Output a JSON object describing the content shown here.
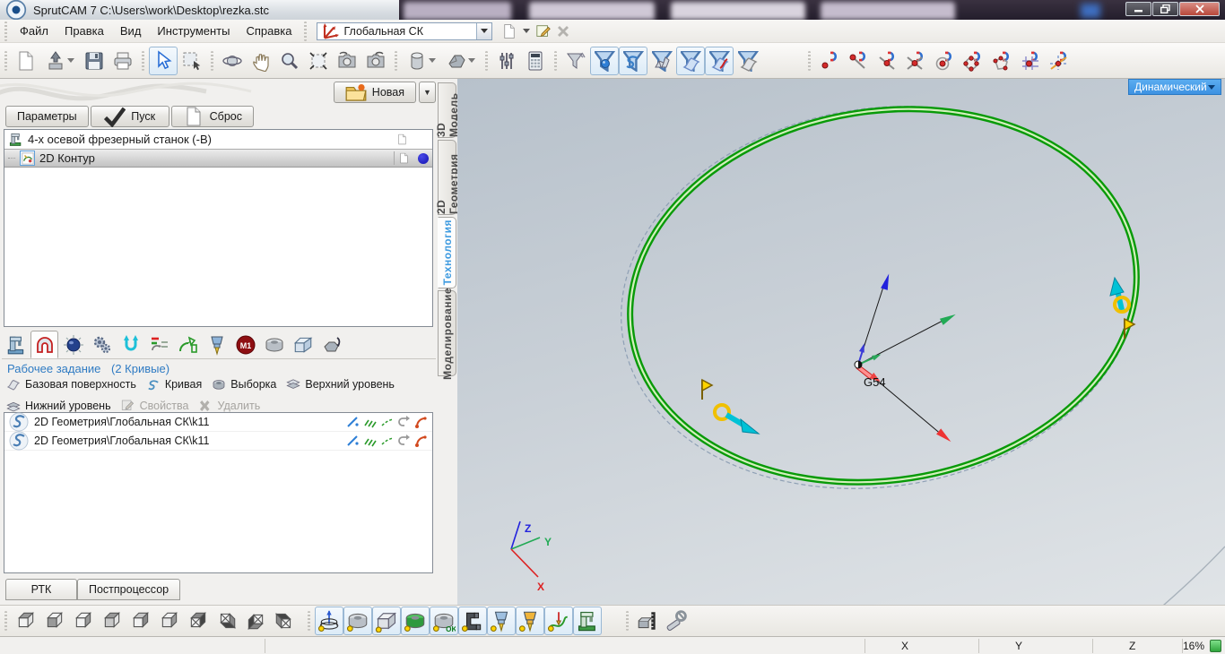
{
  "window": {
    "title": "SprutCAM 7   C:\\Users\\work\\Desktop\\rezka.stc"
  },
  "menu": [
    "Файл",
    "Правка",
    "Вид",
    "Инструменты",
    "Справка"
  ],
  "cs_combo": {
    "value": "Глобальная СК"
  },
  "toolbar_main": [
    "new-document",
    "open-import",
    "save",
    "print",
    "select",
    "rect-select",
    "rotate-view",
    "pan-view",
    "zoom-view",
    "fit-view",
    "snapshot",
    "snapshot-rotate",
    "workpiece-cylinder",
    "solid-model",
    "parameters-sliders",
    "calculator",
    "filter-solid",
    "filter-point",
    "filter-curve",
    "filter-mesh",
    "filter-surface",
    "filter-surface-edges",
    "filter-sheet"
  ],
  "toolbar_snap": [
    "snap-point",
    "snap-endpoint",
    "snap-midpoint",
    "snap-intersection",
    "snap-center",
    "snap-quadrant",
    "snap-polygon",
    "snap-grid",
    "snap-axis"
  ],
  "machining": {
    "new_button": "Новая",
    "buttons": [
      "Параметры",
      "Пуск",
      "Сброс"
    ],
    "tree": [
      {
        "label": "4-х осевой фрезерный станок (-B)"
      },
      {
        "label": "2D Контур"
      }
    ],
    "tab_icons": [
      "machine",
      "workpiece-job",
      "simulation",
      "parameters",
      "strategy",
      "feeds",
      "lead-in",
      "tool",
      "stop-m1",
      "part",
      "workpiece-box",
      "transform"
    ],
    "section_title": "Рабочее задание",
    "section_count": "(2 Кривые)",
    "actions": [
      "Базовая поверхность",
      "Кривая",
      "Выборка",
      "Верхний уровень",
      "Нижний уровень",
      "Свойства",
      "Удалить"
    ],
    "items": [
      "2D Геометрия\\Глобальная СК\\k11",
      "2D Геометрия\\Глобальная СК\\k11"
    ],
    "bottom_tabs": [
      "РТК",
      "Постпроцессор"
    ]
  },
  "side_tabs": [
    "3D Модель",
    "2D Геометрия",
    "Технология",
    "Моделирование"
  ],
  "viewport": {
    "mode": "Динамический",
    "origin_label": "G54",
    "axis": {
      "x": "X",
      "y": "Y",
      "z": "Z"
    }
  },
  "bottom_toolbar": [
    "view-top",
    "view-front",
    "view-left",
    "view-right",
    "view-back",
    "view-bottom",
    "view-iso-1",
    "view-iso-2",
    "view-iso-3",
    "view-iso-4",
    "show-machine-structure",
    "show-workpiece",
    "show-stock-box",
    "show-part",
    "show-result-ok",
    "show-fixtures",
    "show-tool",
    "show-tool-holder",
    "show-toolpath",
    "show-machine",
    "measure",
    "fasteners"
  ],
  "status": {
    "x_label": "X",
    "y_label": "Y",
    "z_label": "Z",
    "zoom": "16%"
  },
  "icons": {
    "m1": "M1",
    "ok": "OK"
  },
  "colors": {
    "accent": "#3d9be9",
    "contour_green": "#00a000",
    "selection_dot": "#1b1bd0"
  }
}
